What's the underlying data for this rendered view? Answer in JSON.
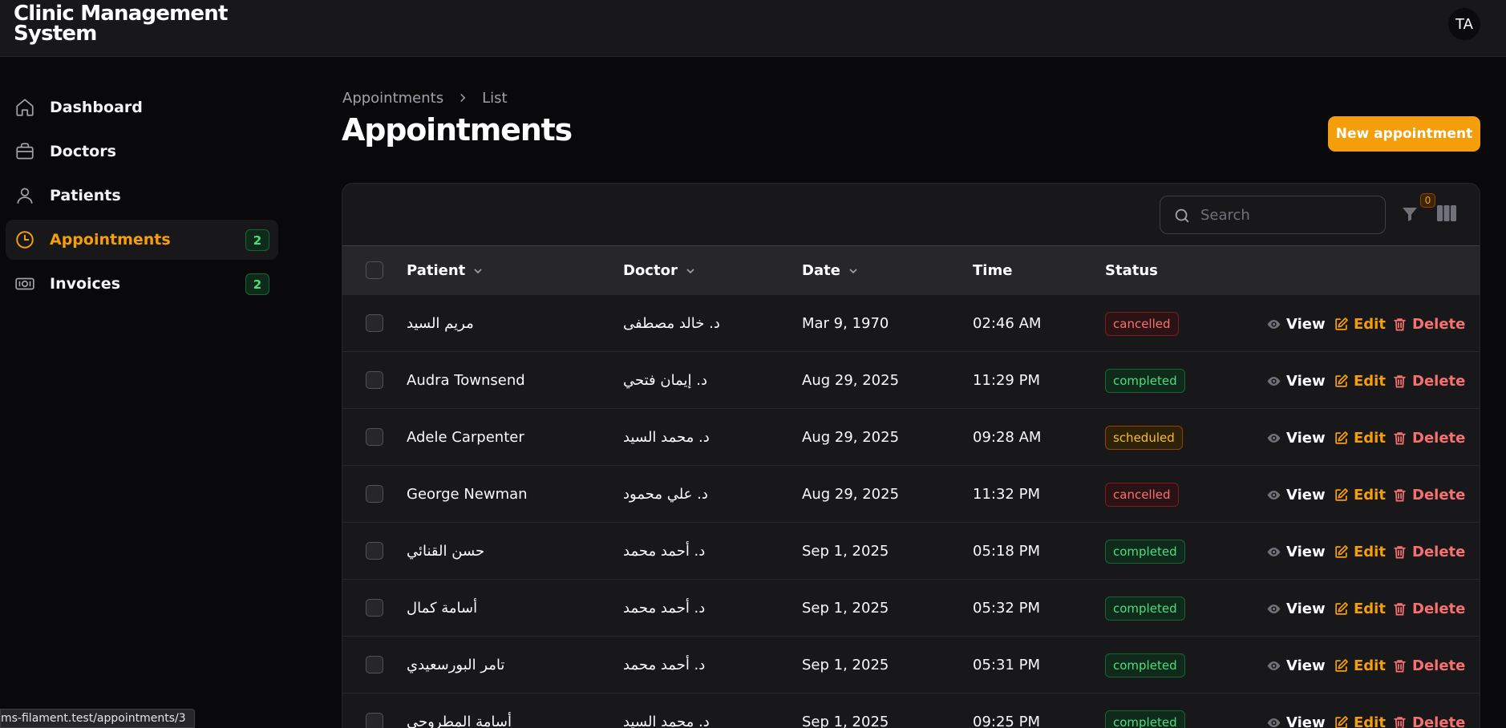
{
  "app": {
    "title": "Clinic Management System",
    "avatar_initials": "TA"
  },
  "sidebar": {
    "items": [
      {
        "label": "Dashboard",
        "icon": "home-icon",
        "active": false,
        "badge": null
      },
      {
        "label": "Doctors",
        "icon": "briefcase-icon",
        "active": false,
        "badge": null
      },
      {
        "label": "Patients",
        "icon": "user-icon",
        "active": false,
        "badge": null
      },
      {
        "label": "Appointments",
        "icon": "clock-icon",
        "active": true,
        "badge": "2"
      },
      {
        "label": "Invoices",
        "icon": "banknote-icon",
        "active": false,
        "badge": "2"
      }
    ]
  },
  "breadcrumb": {
    "parent": "Appointments",
    "current": "List"
  },
  "page": {
    "title": "Appointments",
    "new_button": "New appointment"
  },
  "toolbar": {
    "search_placeholder": "Search",
    "filter_count": "0"
  },
  "table": {
    "columns": {
      "patient": "Patient",
      "doctor": "Doctor",
      "date": "Date",
      "time": "Time",
      "status": "Status"
    },
    "actions": {
      "view": "View",
      "edit": "Edit",
      "delete": "Delete"
    },
    "rows": [
      {
        "patient": "مريم السيد",
        "doctor": "د. خالد مصطفى",
        "date": "Mar 9, 1970",
        "time": "02:46 AM",
        "status": "cancelled"
      },
      {
        "patient": "Audra Townsend",
        "doctor": "د. إيمان فتحي",
        "date": "Aug 29, 2025",
        "time": "11:29 PM",
        "status": "completed"
      },
      {
        "patient": "Adele Carpenter",
        "doctor": "د. محمد السيد",
        "date": "Aug 29, 2025",
        "time": "09:28 AM",
        "status": "scheduled"
      },
      {
        "patient": "George Newman",
        "doctor": "د. علي محمود",
        "date": "Aug 29, 2025",
        "time": "11:32 PM",
        "status": "cancelled"
      },
      {
        "patient": "حسن القنائي",
        "doctor": "د. أحمد محمد",
        "date": "Sep 1, 2025",
        "time": "05:18 PM",
        "status": "completed"
      },
      {
        "patient": "أسامة كمال",
        "doctor": "د. أحمد محمد",
        "date": "Sep 1, 2025",
        "time": "05:32 PM",
        "status": "completed"
      },
      {
        "patient": "تامر البورسعيدي",
        "doctor": "د. أحمد محمد",
        "date": "Sep 1, 2025",
        "time": "05:31 PM",
        "status": "completed"
      },
      {
        "patient": "أسامة المطروحي",
        "doctor": "د. محمد السيد",
        "date": "Sep 1, 2025",
        "time": "09:25 PM",
        "status": "completed"
      }
    ]
  },
  "colors": {
    "accent": "#f59e0b",
    "success": "#4ade80",
    "danger": "#f87171"
  },
  "status_bar": {
    "url": "ms-filament.test/appointments/3"
  }
}
